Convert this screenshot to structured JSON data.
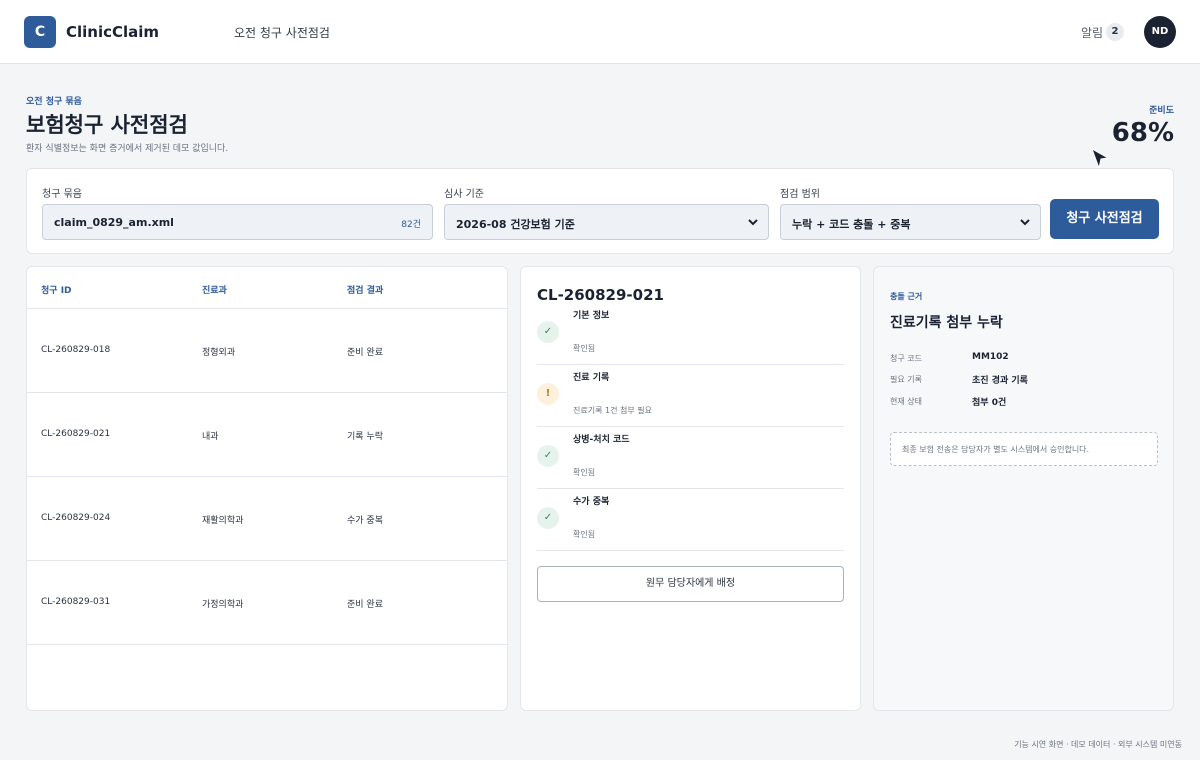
{
  "app": {
    "logo_letter": "C",
    "name": "ClinicClaim",
    "nav_label": "오전 청구 사전점검",
    "notifications_label": "알림",
    "notifications_count": "2",
    "avatar_initials": "ND"
  },
  "header": {
    "eyebrow": "오전 청구 묶음",
    "title": "보험청구 사전점검",
    "subtitle": "환자 식별정보는 화면 증거에서 제거된 데모 값입니다.",
    "readiness_label": "준비도",
    "readiness_value": "68%",
    "readiness_percent": 68
  },
  "filters": {
    "bundle_label": "청구 묶음",
    "bundle_value": "claim_0829_am.xml",
    "bundle_count": "82건",
    "standard_label": "심사 기준",
    "standard_value": "2026-08 건강보험 기준",
    "scope_label": "점검 범위",
    "scope_value": "누락 + 코드 충돌 + 중복",
    "run_button": "청구 사전점검"
  },
  "claims_table": {
    "headers": [
      "청구 ID",
      "진료과",
      "점검 결과"
    ],
    "rows": [
      {
        "id": "CL-260829-018",
        "dept": "정형외과",
        "result": "준비 완료"
      },
      {
        "id": "CL-260829-021",
        "dept": "내과",
        "result": "기록 누락"
      },
      {
        "id": "CL-260829-024",
        "dept": "재활의학과",
        "result": "수가 중복"
      },
      {
        "id": "CL-260829-031",
        "dept": "가정의학과",
        "result": "준비 완료"
      }
    ]
  },
  "detail": {
    "claim_id": "CL-260829-021",
    "checks": [
      {
        "status": "ok",
        "icon": "✓",
        "title": "기본 정보",
        "desc": "확인됨"
      },
      {
        "status": "warn",
        "icon": "!",
        "title": "진료 기록",
        "desc": "진료기록 1건 첨부 필요"
      },
      {
        "status": "ok",
        "icon": "✓",
        "title": "상병-처치 코드",
        "desc": "확인됨"
      },
      {
        "status": "ok",
        "icon": "✓",
        "title": "수가 중복",
        "desc": "확인됨"
      }
    ],
    "assign_button": "원무 담당자에게 배정"
  },
  "evidence": {
    "eyebrow": "충돌 근거",
    "title": "진료기록 첨부 누락",
    "fields": [
      {
        "key": "청구 코드",
        "value": "MM102"
      },
      {
        "key": "필요 기록",
        "value": "초진 경과 기록"
      },
      {
        "key": "현재 상태",
        "value": "첨부 0건"
      }
    ],
    "note": "최종 보험 전송은 담당자가 별도 시스템에서 승인합니다."
  },
  "footer": "기능 시연 화면 · 데모 데이터 · 외부 시스템 미연동",
  "colors": {
    "brand": "#2e5b99",
    "ink": "#1b2333",
    "ok": "#2f8a5a",
    "warn": "#b9791a"
  }
}
